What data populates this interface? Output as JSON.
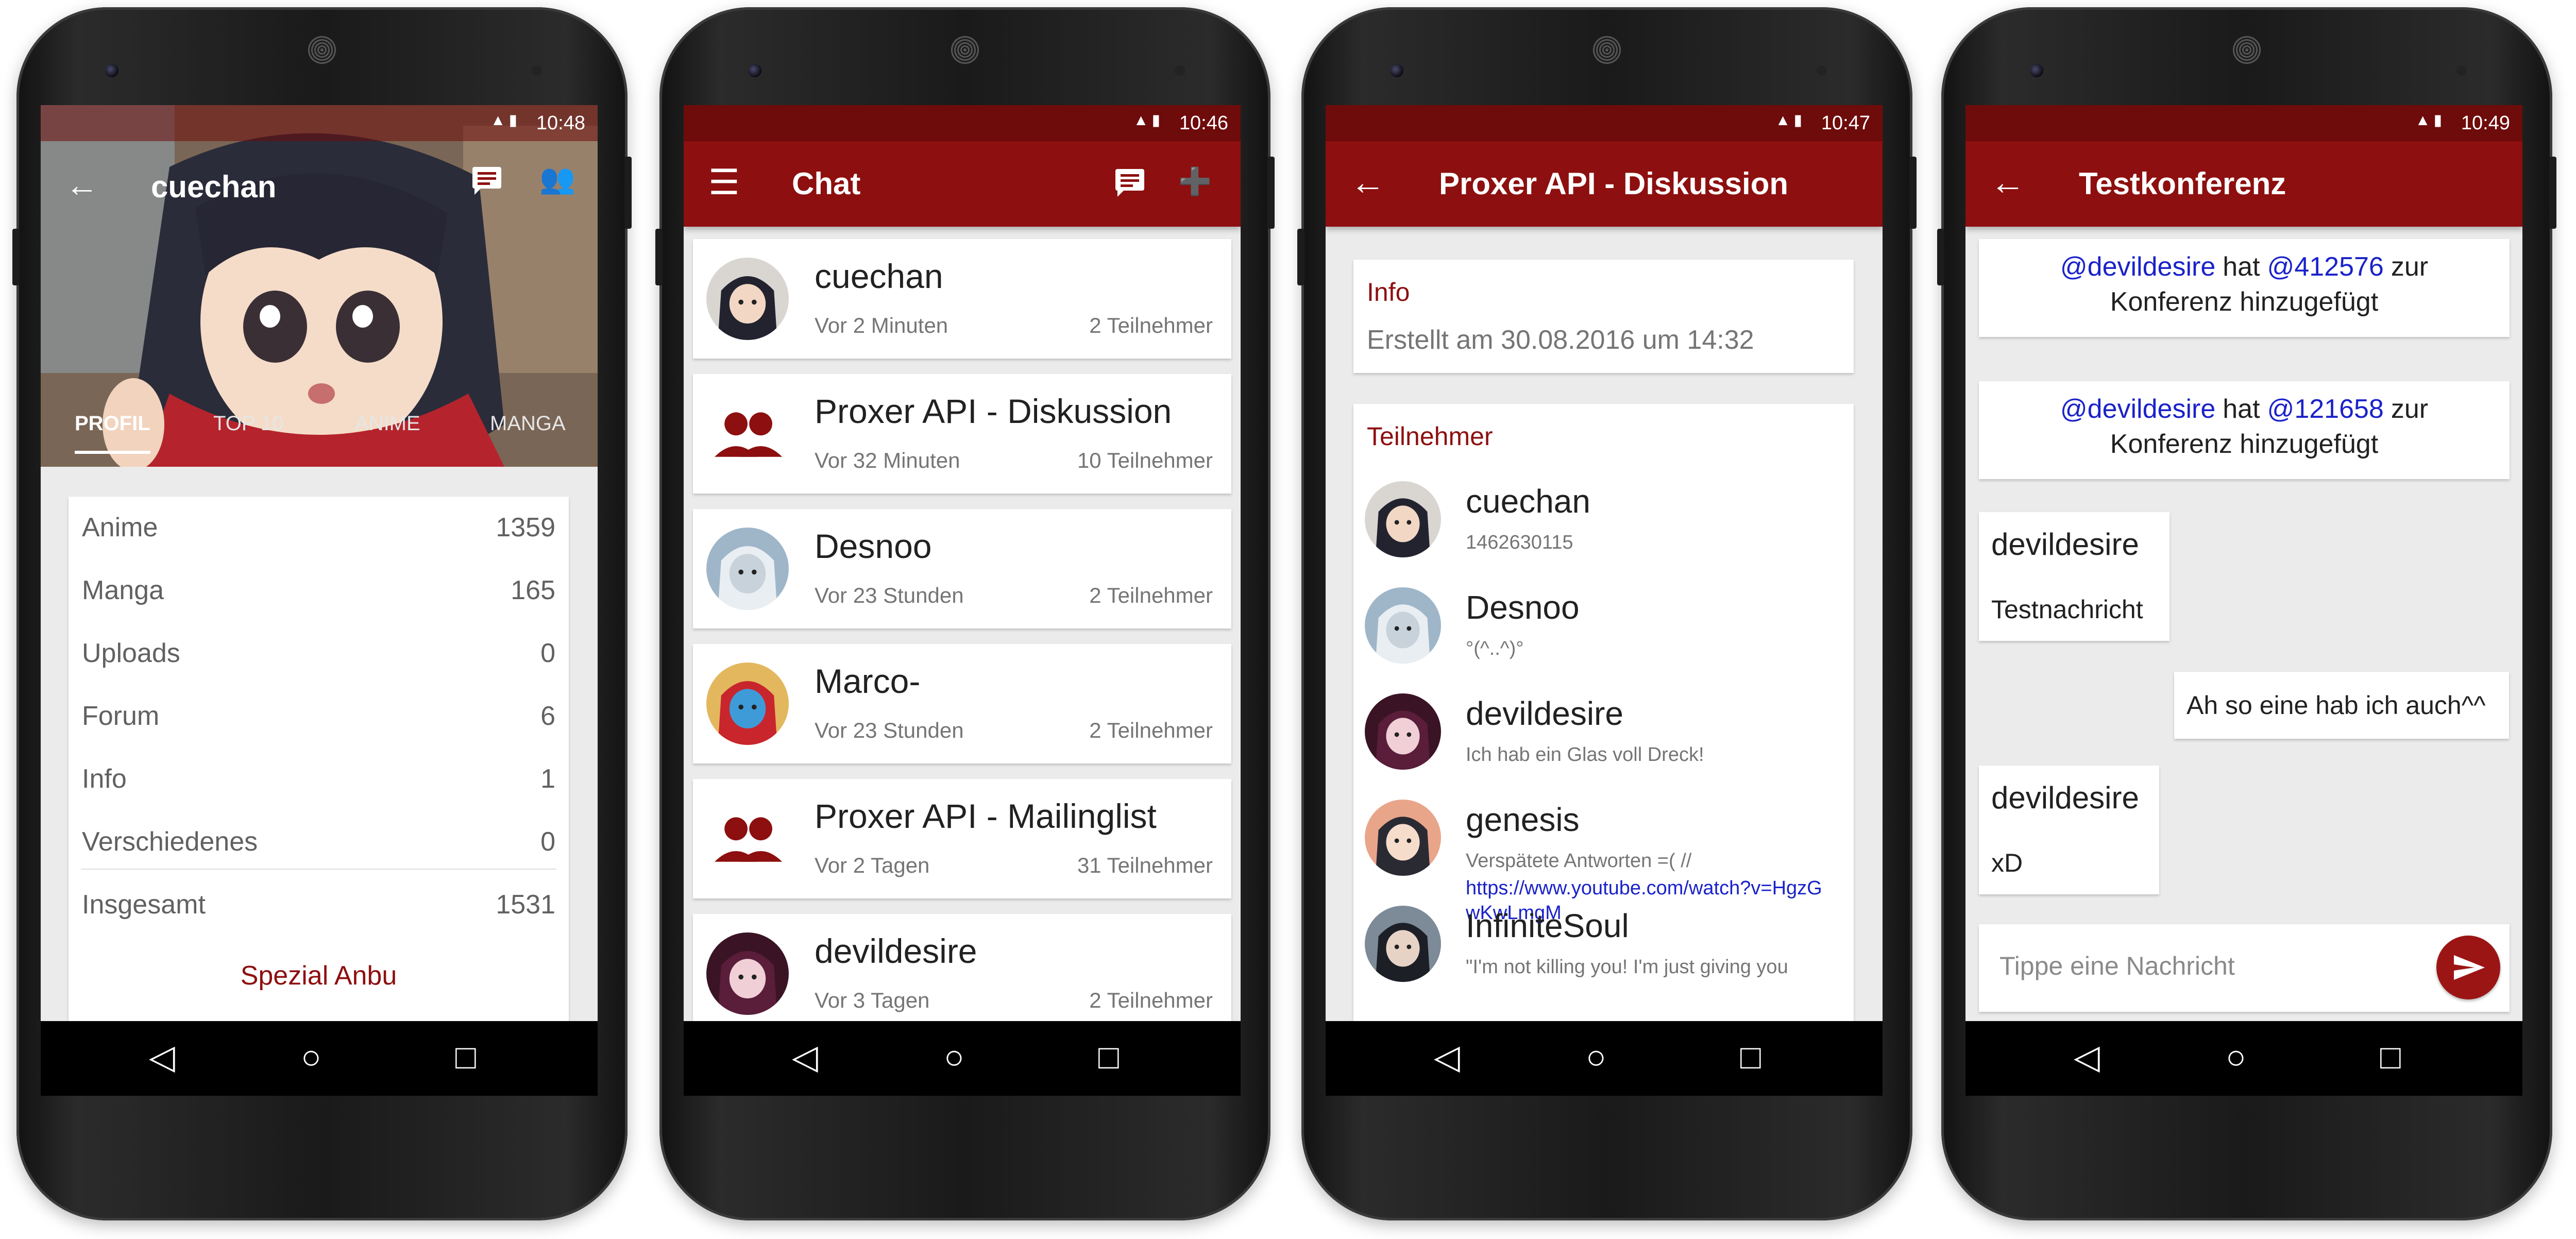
{
  "screens": {
    "profile": {
      "time": "10:48",
      "title": "cuechan",
      "tabs": [
        "PROFIL",
        "TOP 10",
        "ANIME",
        "MANGA"
      ],
      "stats": [
        {
          "label": "Anime",
          "value": "1359"
        },
        {
          "label": "Manga",
          "value": "165"
        },
        {
          "label": "Uploads",
          "value": "0"
        },
        {
          "label": "Forum",
          "value": "6"
        },
        {
          "label": "Info",
          "value": "1"
        },
        {
          "label": "Verschiedenes",
          "value": "0"
        }
      ],
      "total": {
        "label": "Insgesamt",
        "value": "1531"
      },
      "rank": "Spezial Anbu"
    },
    "chat": {
      "time": "10:46",
      "title": "Chat",
      "items": [
        {
          "name": "cuechan",
          "time": "Vor 2 Minuten",
          "participants": "2 Teilnehmer",
          "avatar": "cuechan"
        },
        {
          "name": "Proxer API - Diskussion",
          "time": "Vor 32 Minuten",
          "participants": "10 Teilnehmer",
          "avatar": "group"
        },
        {
          "name": "Desnoo",
          "time": "Vor 23 Stunden",
          "participants": "2 Teilnehmer",
          "avatar": "desnoo"
        },
        {
          "name": "Marco-",
          "time": "Vor 23 Stunden",
          "participants": "2 Teilnehmer",
          "avatar": "marco"
        },
        {
          "name": "Proxer API - Mailinglist",
          "time": "Vor 2 Tagen",
          "participants": "31 Teilnehmer",
          "avatar": "group"
        },
        {
          "name": "devildesire",
          "time": "Vor 3 Tagen",
          "participants": "2 Teilnehmer",
          "avatar": "devil"
        }
      ]
    },
    "conference": {
      "time": "10:47",
      "title": "Proxer API - Diskussion",
      "info_heading": "Info",
      "info_text": "Erstellt am 30.08.2016 um 14:32",
      "members_heading": "Teilnehmer",
      "members": [
        {
          "name": "cuechan",
          "status": "1462630115",
          "avatar": "cuechan"
        },
        {
          "name": "Desnoo",
          "status": "°(^..^)°",
          "avatar": "desnoo"
        },
        {
          "name": "devildesire",
          "status": "Ich hab ein Glas voll Dreck!",
          "avatar": "devil"
        },
        {
          "name": "genesis",
          "status": "Verspätete Antworten =(  //",
          "link": "https://www.youtube.com/watch?v=HgzGwKwLmgM",
          "avatar": "genesis"
        },
        {
          "name": "InfiniteSoul",
          "status": "\"I'm not killing you! I'm just giving you",
          "avatar": "infinite"
        }
      ]
    },
    "testconf": {
      "time": "10:49",
      "title": "Testkonferenz",
      "system_messages": [
        {
          "actor": "@devildesire",
          "mid": "hat",
          "target": "@412576",
          "tail": "zur",
          "line2": "Konferenz hinzugefügt"
        },
        {
          "actor": "@devildesire",
          "mid": "hat",
          "target": "@121658",
          "tail": "zur",
          "line2": "Konferenz hinzugefügt"
        }
      ],
      "messages": [
        {
          "sender": "devildesire",
          "text": "Testnachricht"
        },
        {
          "sender": "",
          "text": "Ah so eine hab ich auch^^"
        },
        {
          "sender": "devildesire",
          "text": "xD"
        }
      ],
      "input_placeholder": "Tippe eine Nachricht"
    }
  },
  "colors": {
    "primary": "#8d0f0f",
    "primary_dark": "#6e0b0b",
    "link": "#1a22c9",
    "background": "#ebebeb"
  }
}
